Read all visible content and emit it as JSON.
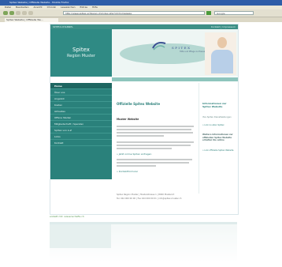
{
  "browser": {
    "window_title": "Spitex Website | Offizielle Website - Mozilla Firefox",
    "menu": [
      "Datei",
      "Bearbeiten",
      "Ansicht",
      "Chronik",
      "Lesezeichen",
      "Extras",
      "Hilfe"
    ],
    "address": "http://www.spitex-schlieren.ch/index.php?id=homepage",
    "search_placeholder": "Google",
    "tab_label": "Spitex Website | Offizielle We..."
  },
  "site": {
    "top_left": "SPITEX-CHANNEL",
    "top_right": "Kontakt | Impressum",
    "brand_line1": "Spitex",
    "brand_line2": "Region Muster",
    "logo_text": "SPITEX",
    "logo_sub": "Hilfe und Pflege zu Hause",
    "nav": [
      "Home",
      "Über uns",
      "Angebot",
      "Kosten",
      "Aktuelles",
      "Offene Stellen",
      "Mitgliedschaft / Spenden",
      "Spitex von A-Z",
      "Links",
      "Kontakt"
    ],
    "main": {
      "heading": "Offizielle Spitex Website",
      "subheading": "Muster Website",
      "link1": "» Jetzt online Spitex anfragen",
      "link2": "» Kontaktformular"
    },
    "side": {
      "heading": "Informationen zur Spitex Website",
      "item1": "Ihre Spitex Dienstleistungen",
      "item2": "» Link zu allen Spitex",
      "item3": "Weitere Informationen zur offiziellen Spitex Website erhalten Sie online",
      "item4": "» Link offizielle Spitex Website"
    },
    "footer": {
      "line1": "Spitex Region Muster | Musterstrasse 1 | 8000 Musterort",
      "line2": "Tel. 044 000 00 00 | Fax 044 000 00 01 | info@spitex-muster.ch"
    },
    "powered_by": "erstellt mit: wissenschafts.ch"
  }
}
